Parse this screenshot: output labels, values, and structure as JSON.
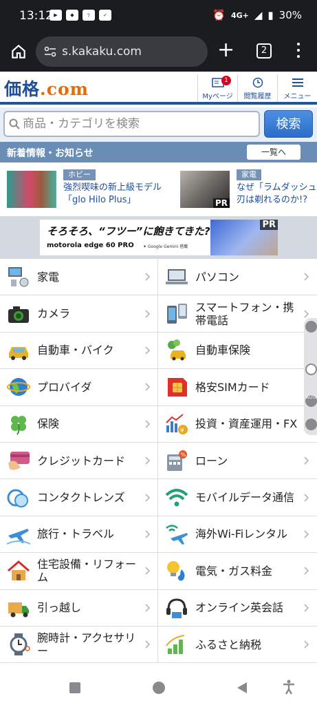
{
  "status": {
    "time": "13:12",
    "network": "4G+",
    "battery": "30%"
  },
  "browser": {
    "url": "s.kakaku.com",
    "tab_count": "2"
  },
  "site": {
    "logo_main": "価格",
    "logo_dot": ".",
    "logo_com": "com",
    "nav": [
      {
        "label": "Myページ",
        "badge": "1"
      },
      {
        "label": "閲覧履歴"
      },
      {
        "label": "メニュー"
      }
    ]
  },
  "search": {
    "placeholder": "商品・カテゴリを検索",
    "button": "検索"
  },
  "news": {
    "header": "新着情報・お知らせ",
    "more": "一覧へ",
    "items": [
      {
        "tag": "ホビー",
        "line1": "強烈喫味の新上級モデル",
        "line2": "「glo Hilo Plus」"
      },
      {
        "tag": "家電",
        "line1": "なぜ「ラムダッシュ",
        "line2": "刃は剃れるのか!?",
        "pr": "PR"
      }
    ]
  },
  "ad": {
    "headline": "そろそろ、“フツー”に飽きてきた?",
    "brand": "motorola edge 60 PRO",
    "sub": "✦ Google Gemini 搭載",
    "pr": "PR"
  },
  "categories": [
    [
      "家電",
      "パソコン"
    ],
    [
      "カメラ",
      "スマートフォン・携帯電話"
    ],
    [
      "自動車・バイク",
      "自動車保険"
    ],
    [
      "プロバイダ",
      "格安SIMカード"
    ],
    [
      "保険",
      "投資・資産運用・FX"
    ],
    [
      "クレジットカード",
      "ローン"
    ],
    [
      "コンタクトレンズ",
      "モバイルデータ通信"
    ],
    [
      "旅行・トラベル",
      "海外Wi-Fiレンタル"
    ],
    [
      "住宅設備・リフォーム",
      "電気・ガス料金"
    ],
    [
      "引っ越し",
      "オンライン英会話"
    ],
    [
      "腕時計・アクセサリー",
      "ふるさと納税"
    ]
  ],
  "side_widget": {
    "text": "ALTO"
  }
}
